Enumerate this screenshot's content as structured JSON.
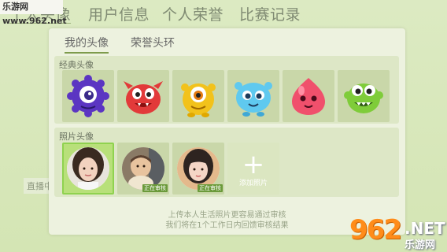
{
  "watermark": "乐游网 www.962.net",
  "top_tabs": [
    {
      "label": "个人头像"
    },
    {
      "label": "用户信息"
    },
    {
      "label": "个人荣誉"
    },
    {
      "label": "比赛记录"
    }
  ],
  "side_label": "直播中",
  "panel": {
    "tabs": [
      {
        "label": "我的头像"
      },
      {
        "label": "荣誉头环"
      }
    ],
    "classic": {
      "title": "经典头像",
      "avatars": [
        {
          "icon": "purple-one-eyed-monster-icon",
          "color": "#6a3fd0"
        },
        {
          "icon": "red-monster-icon",
          "color": "#e23a3a"
        },
        {
          "icon": "yellow-monster-icon",
          "color": "#f2c21b"
        },
        {
          "icon": "blue-monster-icon",
          "color": "#5fc9ef"
        },
        {
          "icon": "pink-blob-icon",
          "color": "#f0506c"
        },
        {
          "icon": "green-monster-icon",
          "color": "#7fcc3a"
        }
      ]
    },
    "photo": {
      "title": "照片头像",
      "items": [
        {
          "icon": "girl-photo-icon",
          "badge": "",
          "skin": "#f2d2bf",
          "hair": "#3a2a20"
        },
        {
          "icon": "baby-photo-icon",
          "badge": "正在审核",
          "skin": "#e8c39e",
          "hair": "#5a4030"
        },
        {
          "icon": "woman-photo-icon",
          "badge": "正在审核",
          "skin": "#f5d6c6",
          "hair": "#2e2420"
        }
      ],
      "add_label": "添加照片"
    },
    "footnote": [
      "上传本人生活照片更容易通过审核",
      "我们将在1个工作日内回馈审核结果"
    ]
  },
  "brand": {
    "number": "962",
    "net": ".NET",
    "cn": "乐游网"
  }
}
